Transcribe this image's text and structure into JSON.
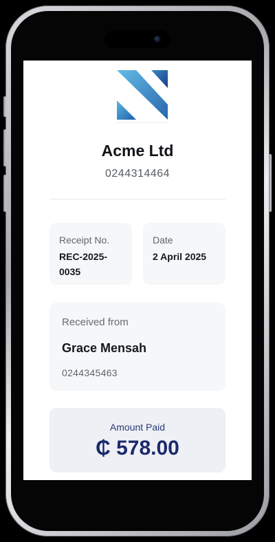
{
  "company": {
    "name": "Acme Ltd",
    "phone": "0244314464"
  },
  "receipt": {
    "number_label": "Receipt No.",
    "number_value": "REC-2025-\n0035",
    "date_label": "Date",
    "date_value": "2 April 2025"
  },
  "payer": {
    "label": "Received from",
    "name": "Grace Mensah",
    "phone": "0244345463"
  },
  "payment": {
    "label": "Amount Paid",
    "amount": "₵ 578.00"
  },
  "colors": {
    "accent": "#1c2a6b",
    "logo_light": "#4aa3d8",
    "logo_dark": "#1f4f9a"
  },
  "icons": {
    "logo": "acme-n-logo"
  }
}
